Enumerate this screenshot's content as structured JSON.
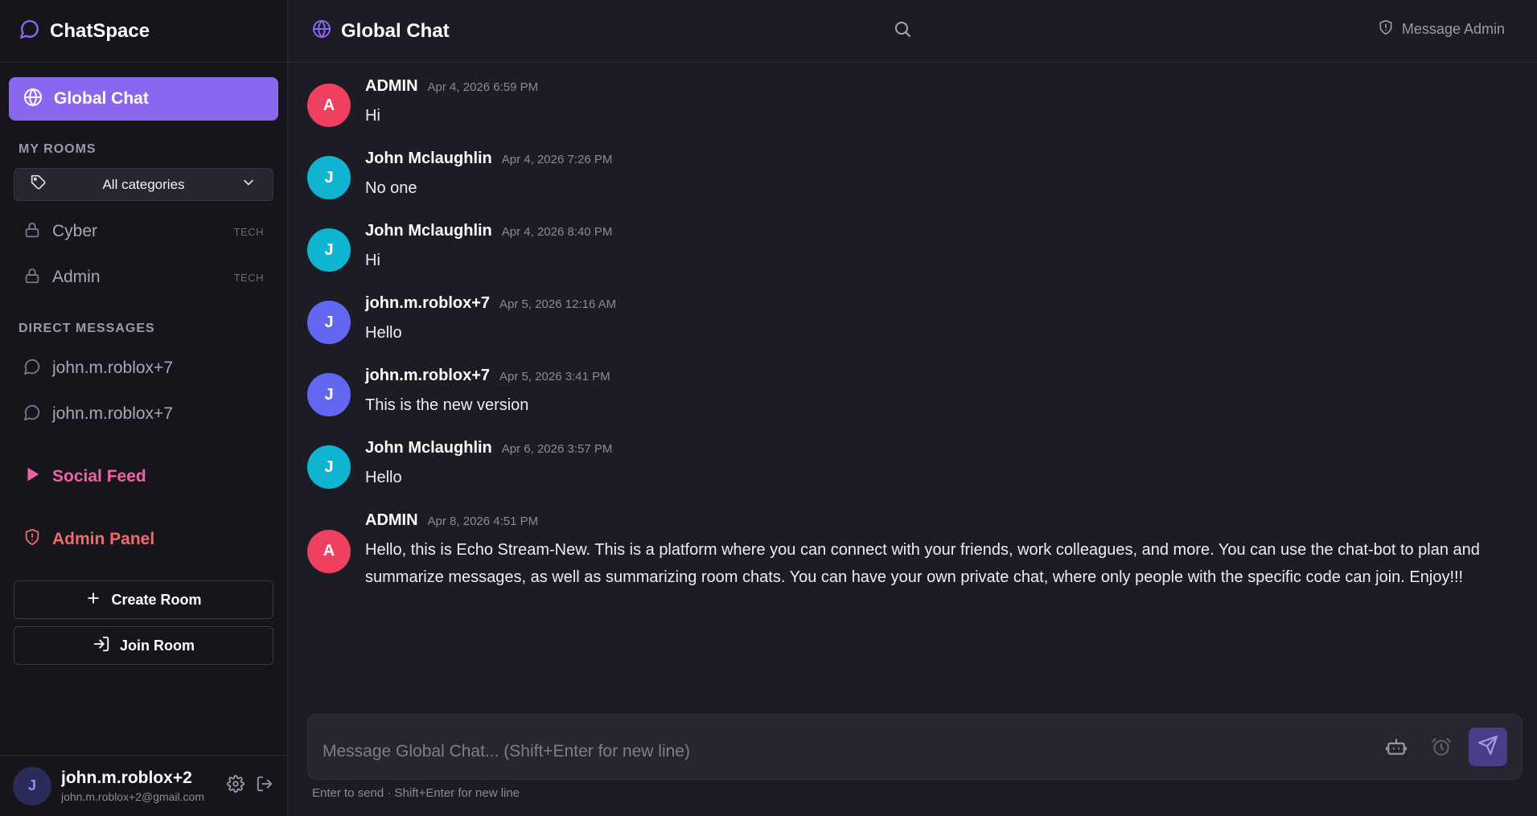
{
  "brand": {
    "name": "ChatSpace"
  },
  "sidebar": {
    "global_label": "Global Chat",
    "my_rooms_title": "MY ROOMS",
    "category_select": "All categories",
    "rooms": [
      {
        "name": "Cyber",
        "tag": "TECH"
      },
      {
        "name": "Admin",
        "tag": "TECH"
      }
    ],
    "dm_title": "DIRECT MESSAGES",
    "dms": [
      {
        "name": "john.m.roblox+7"
      },
      {
        "name": "john.m.roblox+7"
      }
    ],
    "social_feed": "Social Feed",
    "admin_panel": "Admin Panel",
    "create_room": "Create Room",
    "join_room": "Join Room"
  },
  "user": {
    "initial": "J",
    "name": "john.m.roblox+2",
    "email": "john.m.roblox+2@gmail.com"
  },
  "header": {
    "title": "Global Chat",
    "message_admin": "Message Admin"
  },
  "messages": [
    {
      "initial": "A",
      "author": "ADMIN",
      "time": "Apr 4, 2026 6:59 PM",
      "text": "Hi",
      "color": "#f0405f"
    },
    {
      "initial": "J",
      "author": "John Mclaughlin",
      "time": "Apr 4, 2026 7:26 PM",
      "text": "No one",
      "color": "#0fb5d0"
    },
    {
      "initial": "J",
      "author": "John Mclaughlin",
      "time": "Apr 4, 2026 8:40 PM",
      "text": "Hi",
      "color": "#0fb5d0"
    },
    {
      "initial": "J",
      "author": "john.m.roblox+7",
      "time": "Apr 5, 2026 12:16 AM",
      "text": "Hello",
      "color": "#6366f1"
    },
    {
      "initial": "J",
      "author": "john.m.roblox+7",
      "time": "Apr 5, 2026 3:41 PM",
      "text": "This is the new version",
      "color": "#6366f1"
    },
    {
      "initial": "J",
      "author": "John Mclaughlin",
      "time": "Apr 6, 2026 3:57 PM",
      "text": "Hello",
      "color": "#0fb5d0"
    },
    {
      "initial": "A",
      "author": "ADMIN",
      "time": "Apr 8, 2026 4:51 PM",
      "text": "Hello, this is Echo Stream-New. This is a platform where you can connect with your friends, work colleagues, and more. You can use the chat-bot to plan and summarize messages, as well as summarizing room chats. You can have your own private chat, where only people with the specific code can join. Enjoy!!!",
      "color": "#f0405f"
    }
  ],
  "composer": {
    "placeholder": "Message Global Chat... (Shift+Enter for new line)",
    "value": "",
    "hint": "Enter to send · Shift+Enter for new line"
  },
  "colors": {
    "accent": "#8b67f0",
    "social": "#f062a8",
    "admin": "#f06a6a"
  },
  "icons": [
    "chat-bubble-icon",
    "globe-icon",
    "tag-icon",
    "chevron-down-icon",
    "lock-icon",
    "play-icon",
    "shield-alert-icon",
    "plus-icon",
    "login-icon",
    "gear-icon",
    "logout-icon",
    "search-icon",
    "shield-icon",
    "bot-icon",
    "alarm-icon",
    "send-icon"
  ]
}
